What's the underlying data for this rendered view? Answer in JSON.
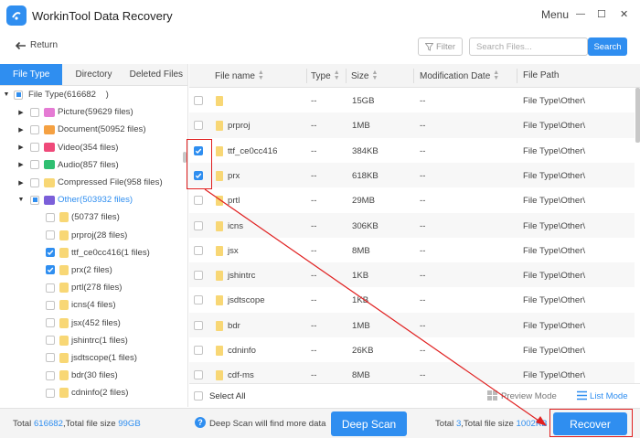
{
  "app": {
    "title": "WorkinTool Data Recovery",
    "menu_label": "Menu",
    "minimize": "—",
    "maximize": "☐",
    "close": "✕"
  },
  "toolbar": {
    "return_label": "Return",
    "filter_label": "Filter",
    "search_placeholder": "Search Files...",
    "search_label": "Search"
  },
  "left_tabs": [
    "File Type",
    "Directory",
    "Deleted Files"
  ],
  "tree": {
    "root": "File Type(616682    )",
    "categories": [
      {
        "label": "Picture(59629 files)",
        "color": "#e57bd4"
      },
      {
        "label": "Document(50952 files)",
        "color": "#f5a142"
      },
      {
        "label": "Video(354 files)",
        "color": "#ef4a7a"
      },
      {
        "label": "Audio(857 files)",
        "color": "#2fbf71"
      },
      {
        "label": "Compressed File(958 files)",
        "color": "#f8d775"
      },
      {
        "label": "Other(503932 files)",
        "color": "#7b5fd9"
      }
    ],
    "other_children": [
      {
        "label": "(50737 files)",
        "checked": false
      },
      {
        "label": "prproj(28 files)",
        "checked": false
      },
      {
        "label": "ttf_ce0cc416(1 files)",
        "checked": true
      },
      {
        "label": "prx(2 files)",
        "checked": true
      },
      {
        "label": "prtl(278 files)",
        "checked": false
      },
      {
        "label": "icns(4 files)",
        "checked": false
      },
      {
        "label": "jsx(452 files)",
        "checked": false
      },
      {
        "label": "jshintrc(1 files)",
        "checked": false
      },
      {
        "label": "jsdtscope(1 files)",
        "checked": false
      },
      {
        "label": "bdr(30 files)",
        "checked": false
      },
      {
        "label": "cdninfo(2 files)",
        "checked": false
      }
    ]
  },
  "table": {
    "headers": [
      "File name",
      "Type",
      "Size",
      "Modification Date",
      "File Path"
    ],
    "rows": [
      {
        "name": "",
        "type": "--",
        "size": "15GB",
        "date": "--",
        "path": "File Type\\Other\\",
        "checked": false
      },
      {
        "name": "prproj",
        "type": "--",
        "size": "1MB",
        "date": "--",
        "path": "File Type\\Other\\",
        "checked": false
      },
      {
        "name": "ttf_ce0cc416",
        "type": "--",
        "size": "384KB",
        "date": "--",
        "path": "File Type\\Other\\",
        "checked": true
      },
      {
        "name": "prx",
        "type": "--",
        "size": "618KB",
        "date": "--",
        "path": "File Type\\Other\\",
        "checked": true
      },
      {
        "name": "prtl",
        "type": "--",
        "size": "29MB",
        "date": "--",
        "path": "File Type\\Other\\",
        "checked": false
      },
      {
        "name": "icns",
        "type": "--",
        "size": "306KB",
        "date": "--",
        "path": "File Type\\Other\\",
        "checked": false
      },
      {
        "name": "jsx",
        "type": "--",
        "size": "8MB",
        "date": "--",
        "path": "File Type\\Other\\",
        "checked": false
      },
      {
        "name": "jshintrc",
        "type": "--",
        "size": "1KB",
        "date": "--",
        "path": "File Type\\Other\\",
        "checked": false
      },
      {
        "name": "jsdtscope",
        "type": "--",
        "size": "1KB",
        "date": "--",
        "path": "File Type\\Other\\",
        "checked": false
      },
      {
        "name": "bdr",
        "type": "--",
        "size": "1MB",
        "date": "--",
        "path": "File Type\\Other\\",
        "checked": false
      },
      {
        "name": "cdninfo",
        "type": "--",
        "size": "26KB",
        "date": "--",
        "path": "File Type\\Other\\",
        "checked": false
      },
      {
        "name": "cdf-ms",
        "type": "--",
        "size": "8MB",
        "date": "--",
        "path": "File Type\\Other\\",
        "checked": false
      }
    ]
  },
  "bottom_bar": {
    "select_all": "Select All",
    "preview_mode": "Preview Mode",
    "list_mode": "List Mode"
  },
  "footer": {
    "total_prefix": "Total ",
    "total_count": "616682",
    "total_mid": ",Total file size ",
    "total_size": "99GB",
    "deep_hint": "Deep Scan will find more data",
    "deep_scan_label": "Deep Scan",
    "selected_prefix": "Total ",
    "selected_count": "3",
    "selected_mid": ",Total file size ",
    "selected_size": "1002KB",
    "recover_label": "Recover"
  },
  "colors": {
    "accent": "#2f8ef0",
    "annotation": "#e02020",
    "folder": "#f8d775"
  }
}
